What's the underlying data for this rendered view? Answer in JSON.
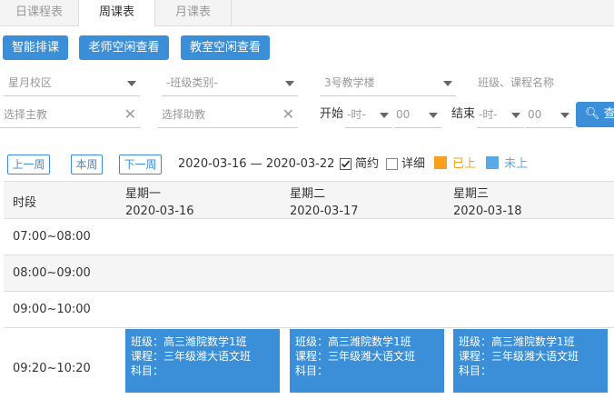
{
  "tabs": [
    {
      "label": "日课程表"
    },
    {
      "label": "周课表"
    },
    {
      "label": "月课表"
    }
  ],
  "actions": {
    "smart": "智能排课",
    "teacher": "老师空闲查看",
    "room": "教室空闲查看"
  },
  "filters": {
    "campus": "星月校区",
    "class_type": "-班级类别-",
    "building": "3号教学楼",
    "search_placeholder": "班级、课程名称",
    "teacher": "选择主教",
    "assistant": "选择助教",
    "start_label": "开始",
    "start_hour": "-时-",
    "start_min": "00",
    "end_label": "结束",
    "end_hour": "-时-",
    "end_min": "00",
    "search_button": "查"
  },
  "week": {
    "prev": "上一周",
    "current": "本周",
    "next": "下一周",
    "range": "2020-03-16 — 2020-03-22",
    "simple_label": "简约",
    "simple_checked": true,
    "detail_label": "详细",
    "detail_checked": false,
    "done_label": "已上",
    "done_color": "#f7a01e",
    "pending_label": "未上",
    "pending_color": "#5aa9e6"
  },
  "schedule": {
    "time_header": "时段",
    "days": [
      {
        "name": "星期一",
        "date": "2020-03-16"
      },
      {
        "name": "星期二",
        "date": "2020-03-17"
      },
      {
        "name": "星期三",
        "date": "2020-03-18"
      }
    ],
    "slots": [
      "07:00~08:00",
      "08:00~09:00",
      "09:00~10:00",
      "09:20~10:20"
    ],
    "cards": [
      {
        "class": "班级：高三潍院数学1班",
        "course": "课程：三年级潍大语文班",
        "subject": "科目："
      },
      {
        "class": "班级：高三潍院数学1班",
        "course": "课程：三年级潍大语文班",
        "subject": "科目："
      },
      {
        "class": "班级：高三潍院数学1班",
        "course": "课程：三年级潍大语文班",
        "subject": "科目："
      }
    ]
  }
}
